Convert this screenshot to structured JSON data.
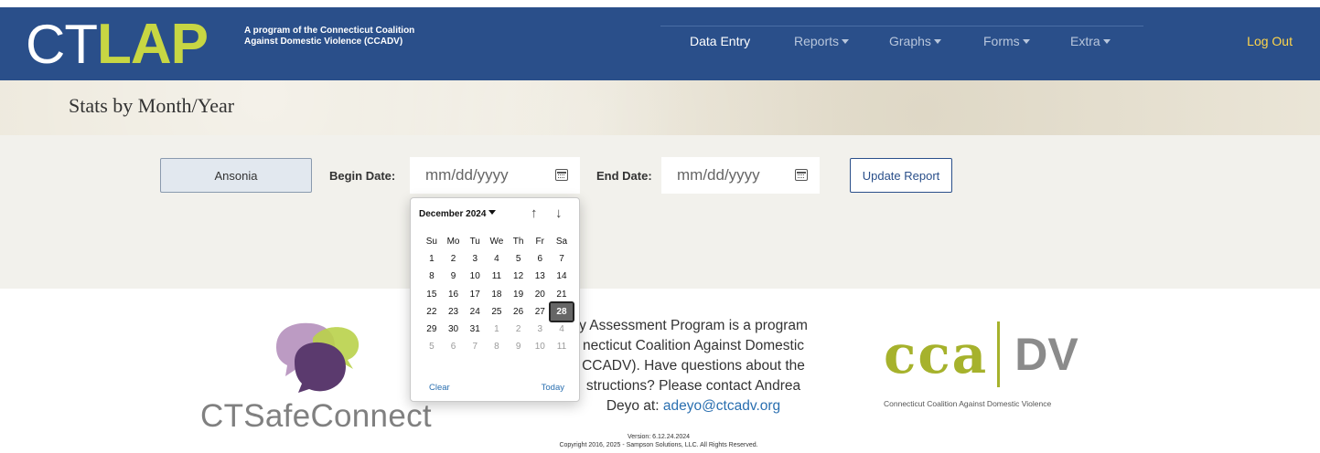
{
  "brand": {
    "logo_ct": "CT",
    "logo_lap": "LAP",
    "tagline_line1": "A program of the Connecticut Coalition",
    "tagline_line2": "Against Domestic Violence (CCADV)"
  },
  "nav": {
    "data_entry": "Data Entry",
    "reports": "Reports",
    "graphs": "Graphs",
    "forms": "Forms",
    "extra": "Extra",
    "logout": "Log Out"
  },
  "page": {
    "title": "Stats by Month/Year"
  },
  "filters": {
    "location": "Ansonia",
    "begin_label": "Begin Date:",
    "begin_placeholder": "mm/dd/yyyy",
    "end_label": "End Date:",
    "end_placeholder": "mm/dd/yyyy",
    "update_button": "Update Report"
  },
  "datepicker": {
    "month_label": "December 2024",
    "weekdays": [
      "Su",
      "Mo",
      "Tu",
      "We",
      "Th",
      "Fr",
      "Sa"
    ],
    "weeks": [
      [
        {
          "d": "1"
        },
        {
          "d": "2"
        },
        {
          "d": "3"
        },
        {
          "d": "4"
        },
        {
          "d": "5"
        },
        {
          "d": "6"
        },
        {
          "d": "7"
        }
      ],
      [
        {
          "d": "8"
        },
        {
          "d": "9"
        },
        {
          "d": "10"
        },
        {
          "d": "11"
        },
        {
          "d": "12"
        },
        {
          "d": "13"
        },
        {
          "d": "14"
        }
      ],
      [
        {
          "d": "15"
        },
        {
          "d": "16"
        },
        {
          "d": "17"
        },
        {
          "d": "18"
        },
        {
          "d": "19"
        },
        {
          "d": "20"
        },
        {
          "d": "21"
        }
      ],
      [
        {
          "d": "22"
        },
        {
          "d": "23"
        },
        {
          "d": "24"
        },
        {
          "d": "25"
        },
        {
          "d": "26"
        },
        {
          "d": "27"
        },
        {
          "d": "28",
          "selected": true
        }
      ],
      [
        {
          "d": "29"
        },
        {
          "d": "30"
        },
        {
          "d": "31"
        },
        {
          "d": "1",
          "other": true
        },
        {
          "d": "2",
          "other": true
        },
        {
          "d": "3",
          "other": true
        },
        {
          "d": "4",
          "other": true
        }
      ],
      [
        {
          "d": "5",
          "other": true
        },
        {
          "d": "6",
          "other": true
        },
        {
          "d": "7",
          "other": true
        },
        {
          "d": "8",
          "other": true
        },
        {
          "d": "9",
          "other": true
        },
        {
          "d": "10",
          "other": true
        },
        {
          "d": "11",
          "other": true
        }
      ]
    ],
    "clear_label": "Clear",
    "today_label": "Today"
  },
  "footer": {
    "ctsafe_text": "CTSafeConnect",
    "about_line1": "y Assessment Program is a program",
    "about_line2": "necticut Coalition Against Domestic",
    "about_line3": "CCADV). Have questions about the",
    "about_line4": "structions? Please contact Andrea",
    "about_line5_prefix": "Deyo at: ",
    "contact_email": "adeyo@ctcadv.org",
    "ccadv_cca": "cca",
    "ccadv_dv": "DV",
    "ccadv_sub": "Connecticut Coalition Against Domestic Violence",
    "version": "Version: 6.12.24.2024",
    "copyright": "Copyright 2016, 2025 - Sampson Solutions, LLC. All Rights Reserved."
  },
  "colors": {
    "navbar": "#2a4f8a",
    "brand_green": "#c7d643",
    "logout": "#ffd54a",
    "link": "#2a6fb0",
    "ccadv_green": "#a6b22c"
  },
  "icons": [
    "calendar-icon",
    "chevron-down-icon",
    "arrow-up-icon",
    "arrow-down-icon"
  ]
}
